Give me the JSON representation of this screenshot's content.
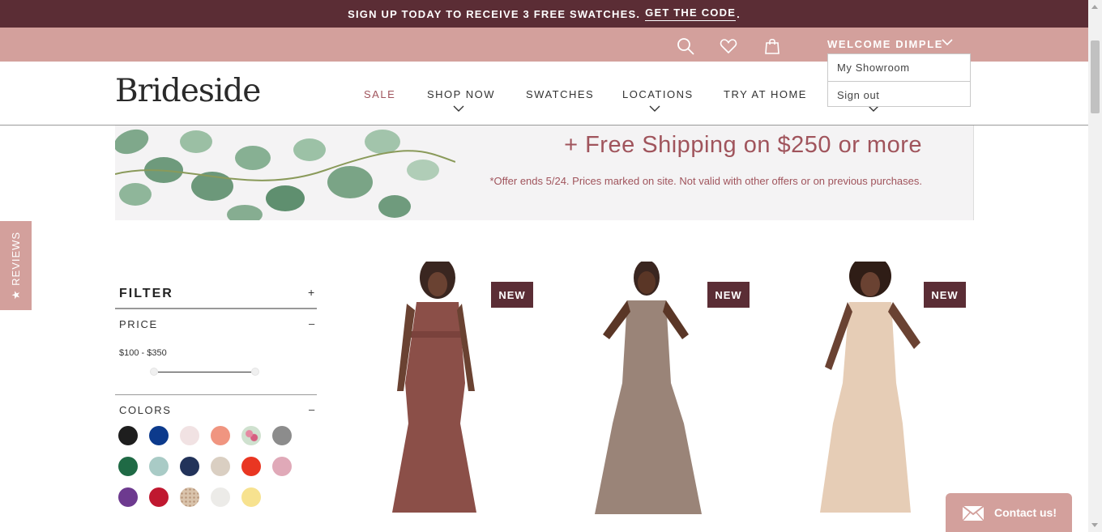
{
  "promo": {
    "text": "SIGN UP TODAY TO RECEIVE 3 FREE SWATCHES.",
    "link": "GET THE CODE",
    "period": "."
  },
  "utility": {
    "welcome": "WELCOME DIMPLE",
    "icons": [
      "search-icon",
      "heart-icon",
      "shopping-bag-icon",
      "chevron-down-icon"
    ]
  },
  "account_menu": {
    "items": [
      {
        "label": "My Showroom"
      },
      {
        "label": "Sign out"
      }
    ]
  },
  "header": {
    "logo": "Brideside",
    "nav": [
      {
        "label": "SALE",
        "has_dropdown": false
      },
      {
        "label": "SHOP NOW",
        "has_dropdown": true
      },
      {
        "label": "SWATCHES",
        "has_dropdown": false
      },
      {
        "label": "LOCATIONS",
        "has_dropdown": true
      },
      {
        "label": "TRY AT HOME",
        "has_dropdown": false
      },
      {
        "label": "",
        "has_dropdown": true
      }
    ]
  },
  "banner": {
    "headline": "+ Free Shipping on $250 or more",
    "note": "*Offer ends 5/24. Prices marked on site. Not valid with other offers or on previous purchases."
  },
  "reviews_tab": {
    "label": "★ REVIEWS"
  },
  "filter": {
    "title": "FILTER",
    "toggle": "+",
    "price": {
      "title": "PRICE",
      "toggle": "–",
      "range": "$100 - $350"
    },
    "colors": {
      "title": "COLORS",
      "toggle": "–",
      "swatches": [
        {
          "name": "black",
          "color": "#1e1e1e"
        },
        {
          "name": "royal-blue",
          "color": "#0c3a8c"
        },
        {
          "name": "blush",
          "color": "#f1e2e3"
        },
        {
          "name": "coral",
          "color": "#f09580"
        },
        {
          "name": "floral",
          "color": "#cfe1cf"
        },
        {
          "name": "grey",
          "color": "#8c8c8c"
        },
        {
          "name": "green",
          "color": "#1f6a45"
        },
        {
          "name": "sage",
          "color": "#a9cbc6"
        },
        {
          "name": "navy",
          "color": "#22335a"
        },
        {
          "name": "taupe",
          "color": "#dacfc2"
        },
        {
          "name": "red",
          "color": "#e93622"
        },
        {
          "name": "dusty-pink",
          "color": "#e0a9b8"
        },
        {
          "name": "purple",
          "color": "#6d3a8f"
        },
        {
          "name": "cranberry",
          "color": "#c01830"
        },
        {
          "name": "gold-sparkle",
          "color": "#d9c3ab"
        },
        {
          "name": "ivory",
          "color": "#ecebe8"
        },
        {
          "name": "yellow",
          "color": "#f7e28f"
        }
      ]
    }
  },
  "products": [
    {
      "badge": "NEW",
      "color": "#8b4f48"
    },
    {
      "badge": "NEW",
      "color": "#9a8478"
    },
    {
      "badge": "NEW",
      "color": "#e6cdb6"
    }
  ],
  "contact": {
    "label": "Contact us!"
  }
}
